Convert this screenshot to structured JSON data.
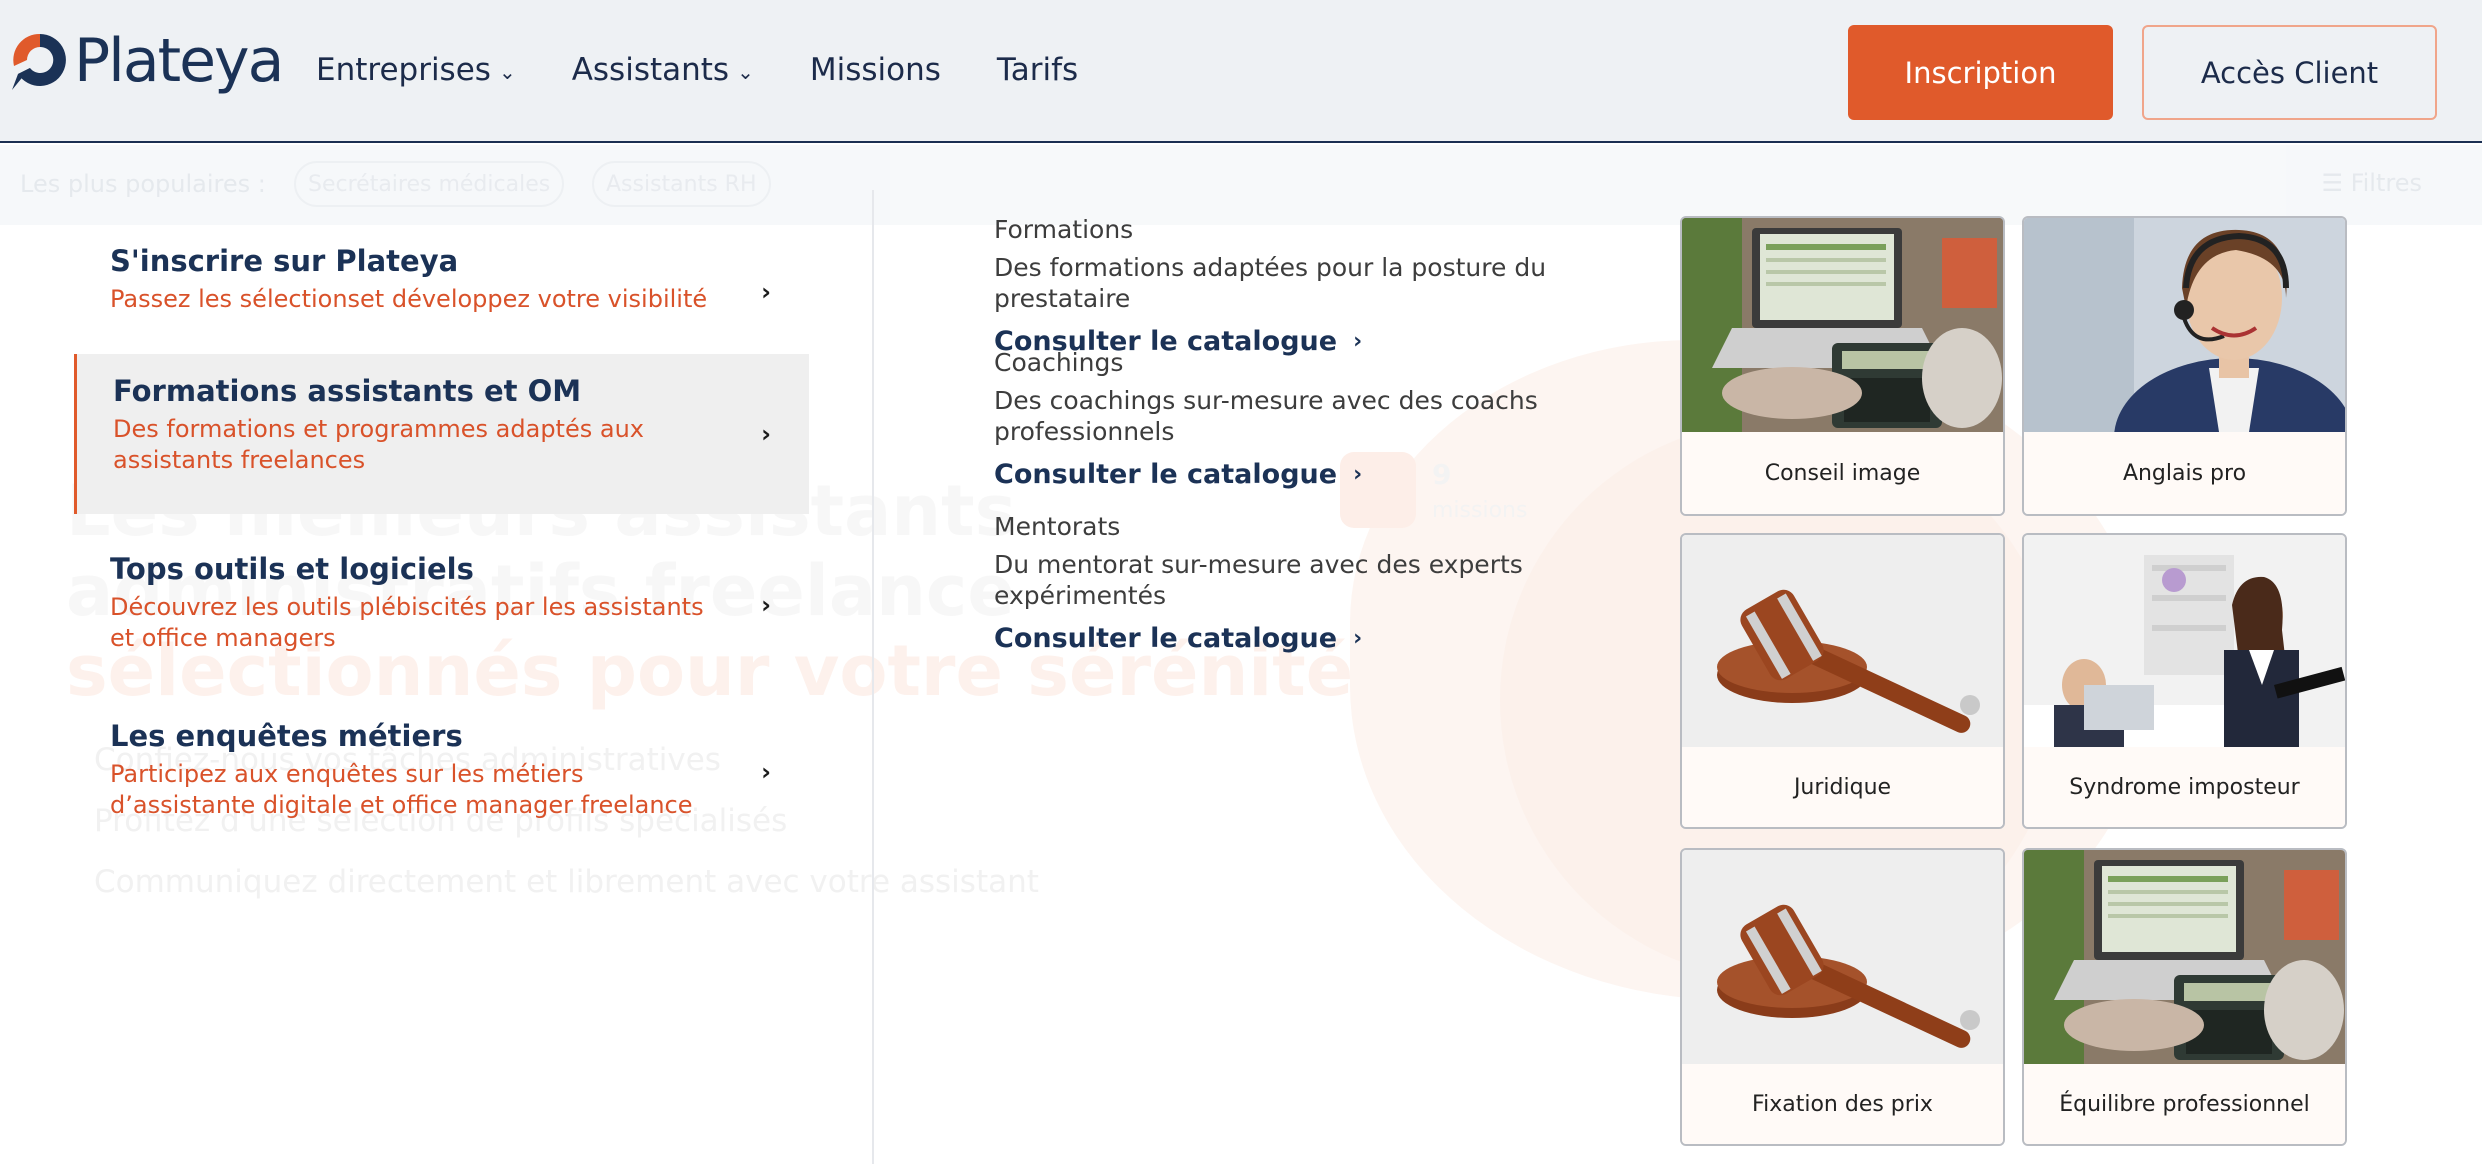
{
  "header": {
    "logo_text": "Plateya",
    "nav": [
      {
        "label": "Entreprises",
        "has_dropdown": true
      },
      {
        "label": "Assistants",
        "has_dropdown": true
      },
      {
        "label": "Missions",
        "has_dropdown": false
      },
      {
        "label": "Tarifs",
        "has_dropdown": false
      }
    ],
    "inscription_label": "Inscription",
    "acces_client_label": "Accès Client",
    "accent_color": "#e05a2b",
    "brand_color": "#1b3256"
  },
  "background": {
    "strip_label": "Les plus populaires :",
    "pills": [
      "Secrétaires médicales",
      "Assistants RH"
    ],
    "filtres": "☰ Filtres",
    "hero_lines": [
      "Les meilleurs assistants",
      "administratifs freelance",
      "sélectionnés pour votre sérénité"
    ],
    "bullets": [
      "Confiez-nous vos tâches administratives",
      "Profitez d'une sélection de profils spécialisés",
      "Communiquez directement et librement avec votre assistant"
    ],
    "badge_number": "9",
    "badge_sub": "missions"
  },
  "menu": {
    "items": [
      {
        "title": "S'inscrire sur Plateya",
        "desc": [
          "Passez les sélectionset développez votre visibilité"
        ],
        "active": false
      },
      {
        "title": "Formations assistants et OM",
        "desc": [
          "Des formations et programmes adaptés aux",
          "assistants freelances"
        ],
        "active": true
      },
      {
        "title": "Tops outils et logiciels",
        "desc": [
          "Découvrez les outils plébiscités par les assistants",
          "et office managers"
        ],
        "active": false
      },
      {
        "title": "Les enquêtes métiers",
        "desc": [
          "Participez aux enquêtes sur les métiers",
          "d’assistante digitale et office manager freelance"
        ],
        "active": false
      }
    ],
    "arrow": "›"
  },
  "sections": [
    {
      "title": "Formations",
      "desc": "Des formations adaptées pour la posture du prestataire",
      "link": "Consulter le catalogue"
    },
    {
      "title": "Coachings",
      "desc": "Des coachings sur-mesure avec des coachs professionnels",
      "link": "Consulter le catalogue"
    },
    {
      "title": "Mentorats",
      "desc": "Du mentorat sur-mesure avec des experts expérimentés",
      "link": "Consulter le catalogue"
    }
  ],
  "link_arrow": "›",
  "cards": [
    {
      "label": "Conseil image",
      "image": "laptop-calculator"
    },
    {
      "label": "Anglais pro",
      "image": "headset-woman"
    },
    {
      "label": "Juridique",
      "image": "gavel"
    },
    {
      "label": "Syndrome imposteur",
      "image": "office-woman"
    },
    {
      "label": "Fixation des prix",
      "image": "gavel"
    },
    {
      "label": "Équilibre professionnel",
      "image": "laptop-calculator"
    }
  ]
}
